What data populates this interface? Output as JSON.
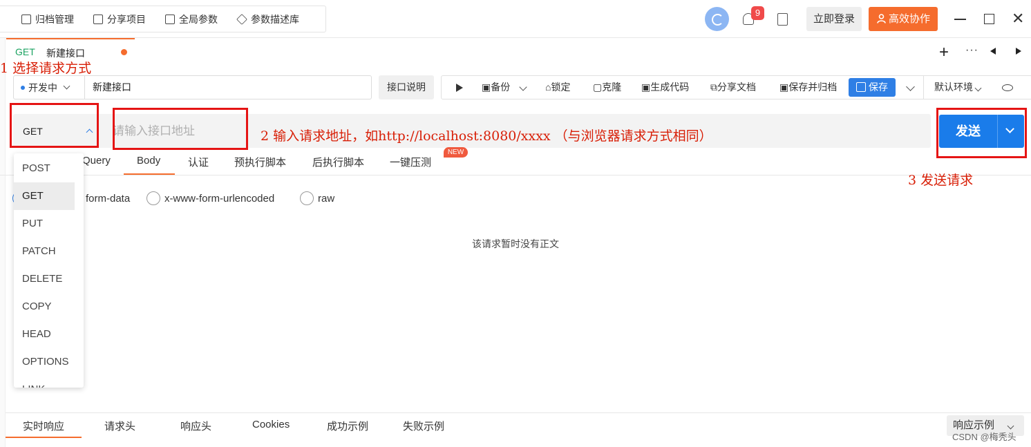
{
  "topbar": {
    "items": [
      {
        "label": "归档管理",
        "icon": "archive-icon"
      },
      {
        "label": "分享项目",
        "icon": "share-icon"
      },
      {
        "label": "全局参数",
        "icon": "params-icon"
      },
      {
        "label": "参数描述库",
        "icon": "cube-icon"
      }
    ],
    "notification_count": "9",
    "login_label": "立即登录",
    "collab_label": "高效协作"
  },
  "tab": {
    "method": "GET",
    "name": "新建接口"
  },
  "annotations": {
    "step1": "1 选择请求方式",
    "step2": "2 输入请求地址，如http://localhost:8080/xxxx （与浏览器请求方式相同）",
    "step3": "3  发送请求"
  },
  "api": {
    "status": "开发中",
    "name": "新建接口",
    "desc_label": "接口说明",
    "actions": [
      "备份",
      "锁定",
      "克隆",
      "生成代码",
      "分享文档",
      "保存并归档"
    ],
    "save_label": "保存",
    "env_label": "默认环境"
  },
  "url": {
    "method": "GET",
    "placeholder": "请输入接口地址",
    "send_label": "发送"
  },
  "request_tabs": [
    "Query",
    "Body",
    "认证",
    "预执行脚本",
    "后执行脚本",
    "一键压测"
  ],
  "new_badge": "NEW",
  "body_types": [
    "form-data",
    "x-www-form-urlencoded",
    "raw"
  ],
  "empty_text": "该请求暂时没有正文",
  "method_options": [
    "POST",
    "GET",
    "PUT",
    "PATCH",
    "DELETE",
    "COPY",
    "HEAD",
    "OPTIONS",
    "LINK"
  ],
  "response_tabs": [
    "实时响应",
    "请求头",
    "响应头",
    "Cookies",
    "成功示例",
    "失败示例"
  ],
  "response_example_label": "响应示例",
  "watermark": "CSDN @梅秃头",
  "colors": {
    "accent": "#f56c2d",
    "primary": "#1a7cea",
    "annotation": "#d81e06",
    "get": "#1aa260"
  }
}
